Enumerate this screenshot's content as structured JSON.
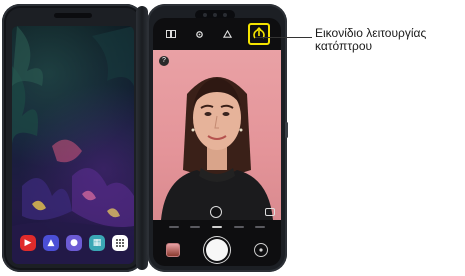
{
  "callout": {
    "label": "Εικονίδιο λειτουργίας κατόπτρου"
  },
  "left_screen": {
    "dock_apps": [
      {
        "name": "youtube-app-icon",
        "color": "#e02b2b",
        "glyph": "▶"
      },
      {
        "name": "gallery-app-icon",
        "color": "#4b4fd6",
        "glyph": "▲"
      },
      {
        "name": "game-app-icon",
        "color": "#6c5bd4",
        "glyph": "●"
      },
      {
        "name": "qr-app-icon",
        "color": "#3aa7b5",
        "glyph": "▦"
      },
      {
        "name": "apps-drawer-icon",
        "color": "#ffffff",
        "glyph": "⋮⋮"
      }
    ]
  },
  "camera": {
    "help_glyph": "?",
    "highlight_color": "#f4e300",
    "viewfinder_color": "#e49499"
  }
}
